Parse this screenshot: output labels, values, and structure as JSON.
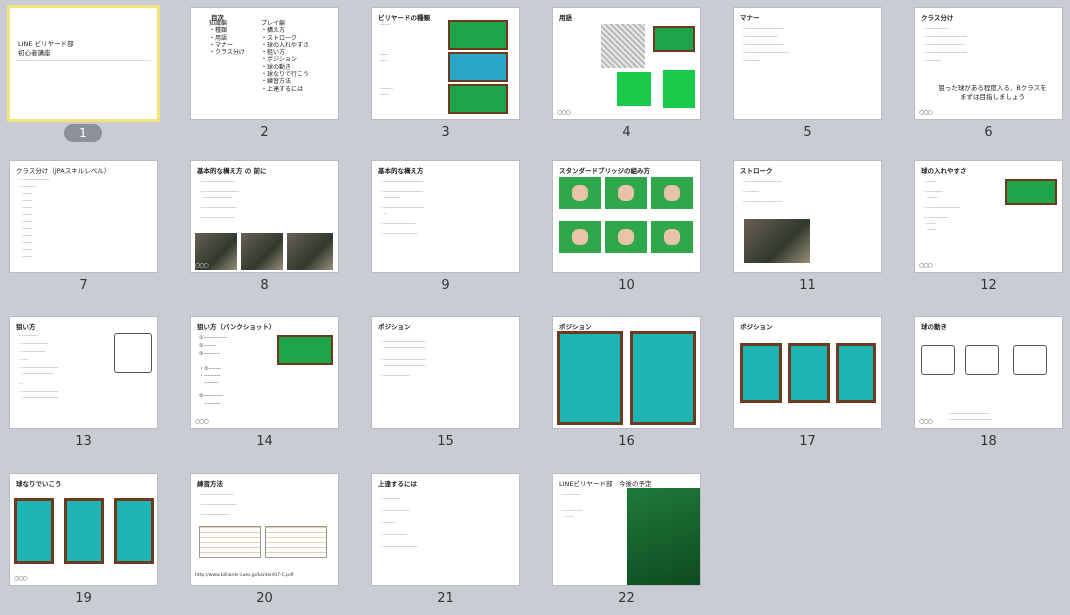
{
  "slides": [
    {
      "num": "1",
      "title": "LINE ビリヤード部\n初心者講座"
    },
    {
      "num": "2",
      "title": "目次",
      "col1": [
        "知識編",
        "・種類",
        "・用語",
        "・マナー",
        "・クラス分け"
      ],
      "col2": [
        "プレイ編",
        "・構え方",
        "・ストローク",
        "・球の入れやすさ",
        "・狙い方",
        "・ポジション",
        "・球の動き",
        "・球なりで行こう",
        "・練習方法",
        "・上達するには"
      ]
    },
    {
      "num": "3",
      "title": "ビリヤードの種類"
    },
    {
      "num": "4",
      "title": "用語"
    },
    {
      "num": "5",
      "title": "マナー"
    },
    {
      "num": "6",
      "title": "クラス分け",
      "note": "狙った球がある程度入る、Bクラスを\nまずは目指しましょう"
    },
    {
      "num": "7",
      "title": "クラス分け（JPAスキルレベル）"
    },
    {
      "num": "8",
      "title": "基本的な構え方 の 前に"
    },
    {
      "num": "9",
      "title": "基本的な構え方"
    },
    {
      "num": "10",
      "title": "スタンダードブリッジの組み方"
    },
    {
      "num": "11",
      "title": "ストローク"
    },
    {
      "num": "12",
      "title": "球の入れやすさ"
    },
    {
      "num": "13",
      "title": "狙い方"
    },
    {
      "num": "14",
      "title": "狙い方（バンクショット）"
    },
    {
      "num": "15",
      "title": "ポジション"
    },
    {
      "num": "16",
      "title": "ポジション"
    },
    {
      "num": "17",
      "title": "ポジション"
    },
    {
      "num": "18",
      "title": "球の動き"
    },
    {
      "num": "19",
      "title": "球なりでいこう"
    },
    {
      "num": "20",
      "title": "練習方法",
      "url": "http://www.billiards-cues.jp/kanteil/07-C.pdf"
    },
    {
      "num": "21",
      "title": "上達するには"
    },
    {
      "num": "22",
      "title": "LINEビリヤード部　今後の予定"
    }
  ],
  "footer_circles": "○○○"
}
